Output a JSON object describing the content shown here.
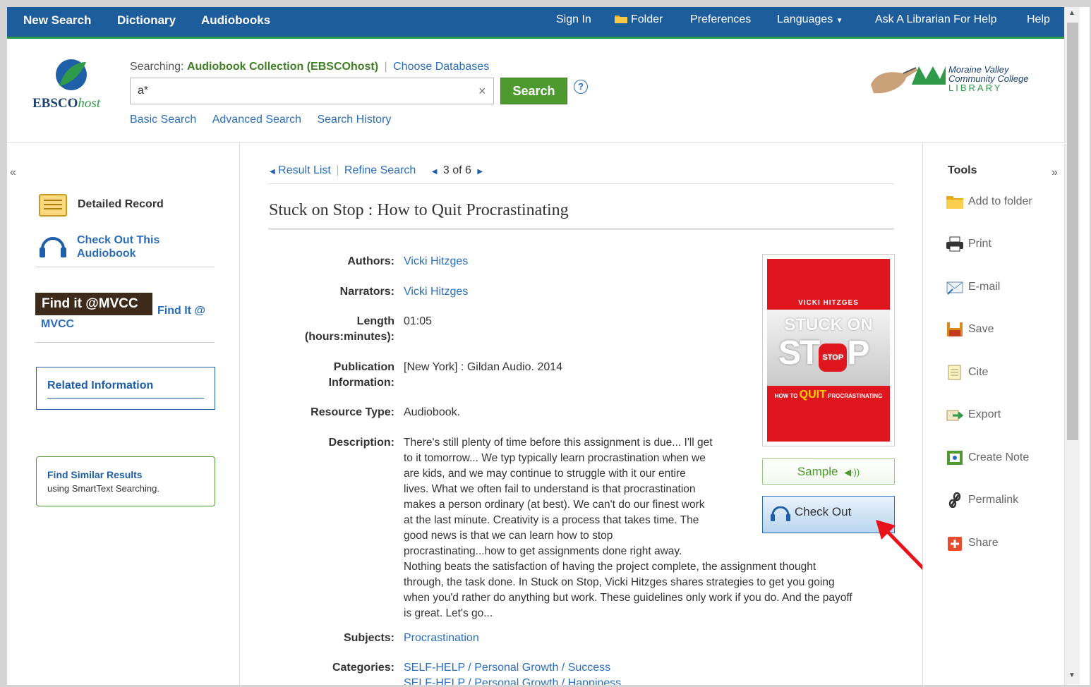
{
  "topnav": {
    "left": [
      "New Search",
      "Dictionary",
      "Audiobooks"
    ],
    "sign_in": "Sign In",
    "folder": "Folder",
    "preferences": "Preferences",
    "languages": "Languages",
    "ask": "Ask A Librarian For Help",
    "help": "Help"
  },
  "header": {
    "logo_text": "EBSCO",
    "logo_host": "host",
    "searching_label": "Searching:",
    "searching_db": "Audiobook Collection (EBSCOhost)",
    "choose_db": "Choose Databases",
    "query": "a*",
    "search_button": "Search",
    "help_glyph": "?",
    "links": [
      "Basic Search",
      "Advanced Search",
      "Search History"
    ],
    "library_line1": "Moraine Valley",
    "library_line2": "Community College",
    "library_line3": "LIBRARY"
  },
  "leftcol": {
    "collapse": "«",
    "detailed_record": "Detailed Record",
    "check_out_1": "Check Out This",
    "check_out_2": "Audiobook",
    "findit_badge": "Find it @MVCC",
    "findit_link_1": "Find It @",
    "findit_link_2": "MVCC",
    "related": "Related Information",
    "similar_title": "Find Similar Results",
    "similar_sub": "using SmartText Searching."
  },
  "nav": {
    "result_list": "Result List",
    "refine": "Refine Search",
    "position": "3 of 6"
  },
  "record": {
    "title": "Stuck on Stop : How to Quit Procrastinating",
    "authors_label": "Authors:",
    "authors": "Vicki Hitzges",
    "narrators_label": "Narrators:",
    "narrators": "Vicki Hitzges",
    "length_label_1": "Length",
    "length_label_2": "(hours:minutes):",
    "length": "01:05",
    "pub_label_1": "Publication",
    "pub_label_2": "Information:",
    "pub": "[New York] : Gildan Audio. 2014",
    "type_label": "Resource Type:",
    "type": "Audiobook.",
    "desc_label": "Description:",
    "desc_lines": [
      "There's still plenty of time before this assignment is due... I'll get",
      "to it tomorrow... We typ typically learn procrastination when we",
      "are kids, and we may continue to struggle with it our entire",
      "lives. What we often fail to understand is that procrastination",
      "makes a person ordinary (at best). We can't do our finest work",
      "at the last minute. Creativity is a process that takes time. The",
      "good news is that we can learn how to stop",
      "procrastinating...how to get assignments done right away.",
      "Nothing beats the satisfaction of having the project complete, the assignment thought",
      "through, the task done. In Stuck on Stop, Vicki Hitzges shares strategies to get you going",
      "when you'd rather do anything but work. These guidelines only work if you do. And the payoff",
      "is great. Let's go..."
    ],
    "subjects_label": "Subjects:",
    "subjects": "Procrastination",
    "categories_label": "Categories:",
    "categories": [
      "SELF-HELP / Personal Growth / Success",
      "SELF-HELP / Personal Growth / Happiness"
    ]
  },
  "cover": {
    "author": "VICKI HITZGES",
    "title_a": "STUCK ON",
    "title_b": "ST",
    "title_stop": "STOP",
    "title_c": "P",
    "subtitle_pre": "HOW TO",
    "subtitle_quit": "QUIT",
    "subtitle_post": "PROCRASTINATING"
  },
  "actions": {
    "sample": "Sample",
    "check_out": "Check Out"
  },
  "tools": {
    "heading": "Tools",
    "expand": "»",
    "items": [
      "Add to folder",
      "Print",
      "E-mail",
      "Save",
      "Cite",
      "Export",
      "Create Note",
      "Permalink",
      "Share"
    ]
  },
  "colors": {
    "topbar": "#1d5d9b",
    "accent_green": "#2f9a4a",
    "link": "#2a6ebb",
    "annotation_arrow": "#e8121b"
  }
}
